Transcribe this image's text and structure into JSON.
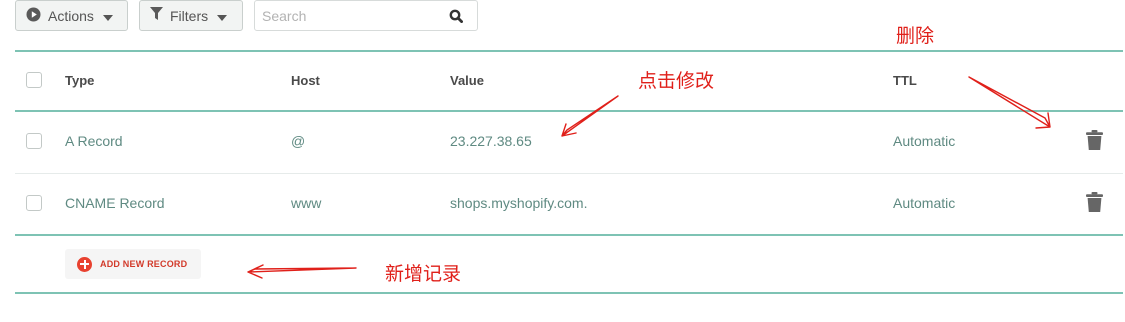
{
  "toolbar": {
    "actions_label": "Actions",
    "filters_label": "Filters",
    "search_placeholder": "Search"
  },
  "table": {
    "columns": [
      "Type",
      "Host",
      "Value",
      "TTL"
    ],
    "rows": [
      {
        "type": "A Record",
        "host": "@",
        "value": "23.227.38.65",
        "ttl": "Automatic"
      },
      {
        "type": "CNAME Record",
        "host": "www",
        "value": "shops.myshopify.com.",
        "ttl": "Automatic"
      }
    ]
  },
  "add_record_label": "ADD NEW RECORD",
  "annotations": {
    "delete": "删除",
    "edit": "点击修改",
    "add": "新增记录"
  },
  "colors": {
    "accent_rule": "#7ec3b4",
    "annotation_red": "#e0201a",
    "add_button_red": "#e8412f"
  },
  "icons": [
    "play-circle-icon",
    "funnel-icon",
    "caret-down-icon",
    "magnifier-icon",
    "trash-icon",
    "plus-circle-icon"
  ]
}
